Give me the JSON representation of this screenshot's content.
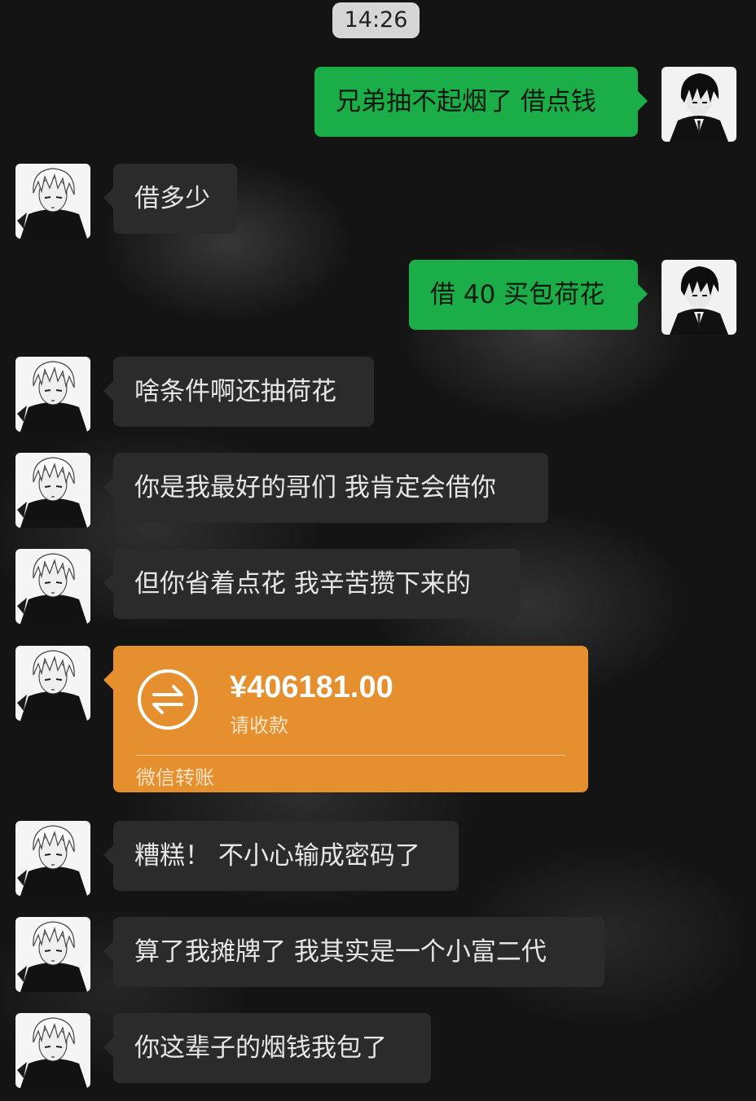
{
  "status": {
    "time": "14:26"
  },
  "messages": [
    {
      "sender": "me",
      "text": "兄弟抽不起烟了 借点钱"
    },
    {
      "sender": "friend",
      "text": "借多少"
    },
    {
      "sender": "me",
      "text": "借 40 买包荷花"
    },
    {
      "sender": "friend",
      "text": "啥条件啊还抽荷花"
    },
    {
      "sender": "friend",
      "text": "你是我最好的哥们 我肯定会借你"
    },
    {
      "sender": "friend",
      "text": "但你省着点花 我辛苦攒下来的"
    },
    {
      "sender": "friend",
      "type": "transfer",
      "amount": "¥406181.00",
      "note": "请收款",
      "footer": "微信转账"
    },
    {
      "sender": "friend",
      "text": "糟糕！ 不小心输成密码了"
    },
    {
      "sender": "friend",
      "text": "算了我摊牌了 我其实是一个小富二代"
    },
    {
      "sender": "friend",
      "text": "你这辈子的烟钱我包了"
    }
  ],
  "colors": {
    "outgoing_bubble": "#1aad48",
    "incoming_bubble": "#2b2b2b",
    "transfer_card": "#e58f2e"
  },
  "icons": {
    "transfer": "transfer-arrows-icon",
    "my_avatar": "dark-haired-anime-avatar",
    "friend_avatar": "white-haired-anime-avatar"
  }
}
